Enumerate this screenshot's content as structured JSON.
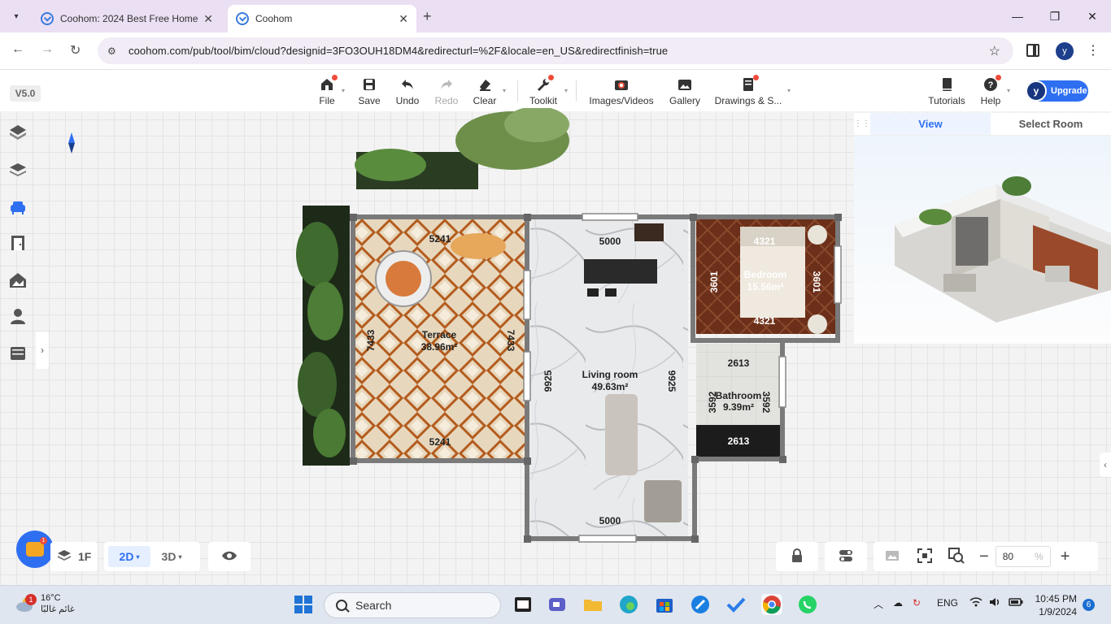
{
  "browser": {
    "tabs": [
      {
        "title": "Coohom: 2024 Best Free Home",
        "active": false
      },
      {
        "title": "Coohom",
        "active": true
      }
    ],
    "url": "coohom.com/pub/tool/bim/cloud?designid=3FO3OUH18DM4&redirecturl=%2F&locale=en_US&redirectfinish=true",
    "profile_initial": "y"
  },
  "app": {
    "version": "V5.0",
    "toolbar": [
      {
        "label": "File",
        "icon": "home-icon"
      },
      {
        "label": "Save",
        "icon": "save-icon"
      },
      {
        "label": "Undo",
        "icon": "undo-icon"
      },
      {
        "label": "Redo",
        "icon": "redo-icon"
      },
      {
        "label": "Clear",
        "icon": "eraser-icon"
      },
      {
        "label": "Toolkit",
        "icon": "wrench-icon"
      },
      {
        "label": "Images/Videos",
        "icon": "camera-icon"
      },
      {
        "label": "Gallery",
        "icon": "gallery-icon"
      },
      {
        "label": "Drawings & S...",
        "icon": "drawing-icon"
      },
      {
        "label": "Tutorials",
        "icon": "book-icon"
      },
      {
        "label": "Help",
        "icon": "help-icon"
      }
    ],
    "upgrade": {
      "initial": "y",
      "label": "Upgrade"
    },
    "minimap": {
      "tab_view": "View",
      "tab_select_room": "Select Room"
    },
    "rooms": {
      "terrace": {
        "name": "Terrace",
        "area": "38.96m²",
        "top": "5241",
        "bottom": "5241",
        "left": "7433",
        "right": "7433"
      },
      "living": {
        "name": "Living room",
        "area": "49.63m²",
        "top": "5000",
        "bottom": "5000",
        "left": "9925",
        "right": "9925"
      },
      "bedroom": {
        "name": "Bedroom",
        "area": "15.56m²",
        "top": "4321",
        "bottom": "4321",
        "left": "3601",
        "right": "3601"
      },
      "bathroom": {
        "name": "Bathroom",
        "area": "9.39m²",
        "top": "2613",
        "bottom": "2613",
        "left": "3592",
        "right": "3592"
      }
    },
    "bottom": {
      "floor": "1F",
      "mode_2d": "2D",
      "mode_3d": "3D",
      "zoom": "80",
      "zoom_unit": "%"
    }
  },
  "taskbar": {
    "temperature": "16°C",
    "weather_desc": "غائم غالبًا",
    "weather_badge": "1",
    "search_placeholder": "Search",
    "language": "ENG",
    "time": "10:45 PM",
    "date": "1/9/2024",
    "notifications": "6"
  }
}
